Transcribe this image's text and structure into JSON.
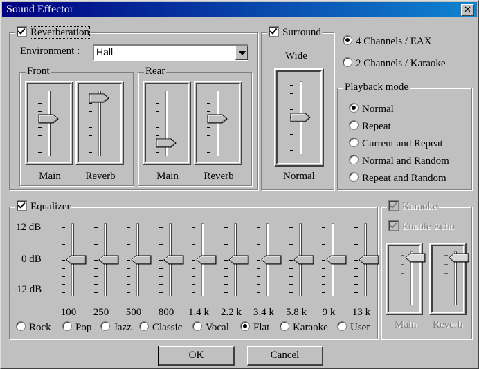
{
  "window": {
    "title": "Sound Effector"
  },
  "reverb": {
    "label": "Reverberation",
    "checked": true,
    "environment_label": "Environment :",
    "environment_value": "Hall",
    "front": {
      "label": "Front",
      "main_label": "Main",
      "reverb_label": "Reverb",
      "main_level": 0.58,
      "reverb_level": 0.95
    },
    "rear": {
      "label": "Rear",
      "main_label": "Main",
      "reverb_label": "Reverb",
      "main_level": 0.15,
      "reverb_level": 0.58
    }
  },
  "surround": {
    "label": "Surround",
    "checked": true,
    "top_label": "Wide",
    "bottom_label": "Normal",
    "level": 0.5
  },
  "channels": [
    {
      "label": "4 Channels / EAX",
      "selected": true
    },
    {
      "label": "2 Channels / Karaoke",
      "selected": false
    }
  ],
  "playback": {
    "label": "Playback mode",
    "options": [
      {
        "label": "Normal",
        "selected": true
      },
      {
        "label": "Repeat",
        "selected": false
      },
      {
        "label": "Current and Repeat",
        "selected": false
      },
      {
        "label": "Normal and Random",
        "selected": false
      },
      {
        "label": "Repeat and Random",
        "selected": false
      }
    ]
  },
  "equalizer": {
    "label": "Equalizer",
    "checked": true,
    "scale": [
      "12 dB",
      "0 dB",
      "-12 dB"
    ],
    "bands": [
      {
        "freq": "100",
        "db": 0
      },
      {
        "freq": "250",
        "db": 0
      },
      {
        "freq": "500",
        "db": 0
      },
      {
        "freq": "800",
        "db": 0
      },
      {
        "freq": "1.4 k",
        "db": 0
      },
      {
        "freq": "2.2 k",
        "db": 0
      },
      {
        "freq": "3.4 k",
        "db": 0
      },
      {
        "freq": "5.8 k",
        "db": 0
      },
      {
        "freq": "9 k",
        "db": 0
      },
      {
        "freq": "13 k",
        "db": 0
      }
    ],
    "presets": [
      {
        "label": "Rock",
        "selected": false
      },
      {
        "label": "Pop",
        "selected": false
      },
      {
        "label": "Jazz",
        "selected": false
      },
      {
        "label": "Classic",
        "selected": false
      },
      {
        "label": "Vocal",
        "selected": false
      },
      {
        "label": "Flat",
        "selected": true
      },
      {
        "label": "Karaoke",
        "selected": false
      },
      {
        "label": "User",
        "selected": false
      }
    ]
  },
  "karaoke": {
    "label": "Karaoke",
    "checked": true,
    "enabled": false,
    "echo_label": "Enable Echo",
    "echo_checked": true,
    "main_label": "Main",
    "reverb_label": "Reverb",
    "main_level": 0.95,
    "reverb_level": 0.95
  },
  "buttons": {
    "ok": "OK",
    "cancel": "Cancel"
  }
}
